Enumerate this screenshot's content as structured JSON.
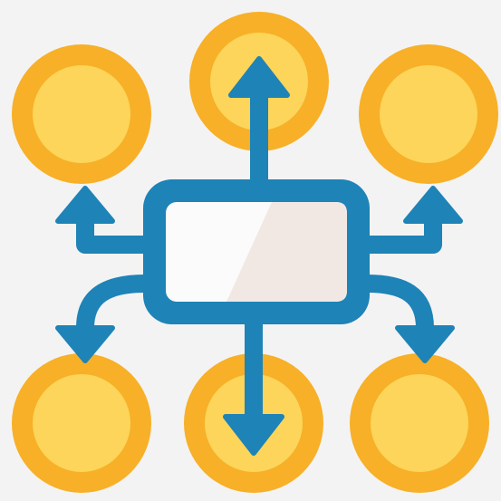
{
  "icon": {
    "name": "distribution-network-icon",
    "nodes": [
      "top",
      "top-left",
      "top-right",
      "bottom-left",
      "bottom-center",
      "bottom-right"
    ]
  },
  "colors": {
    "background": "#f3f3f3",
    "ring": "#f7b027",
    "fill": "#fcd55a",
    "line": "#1e83b7",
    "screen": "#fbfbfb",
    "screen_shade": "#f1e8e4"
  }
}
